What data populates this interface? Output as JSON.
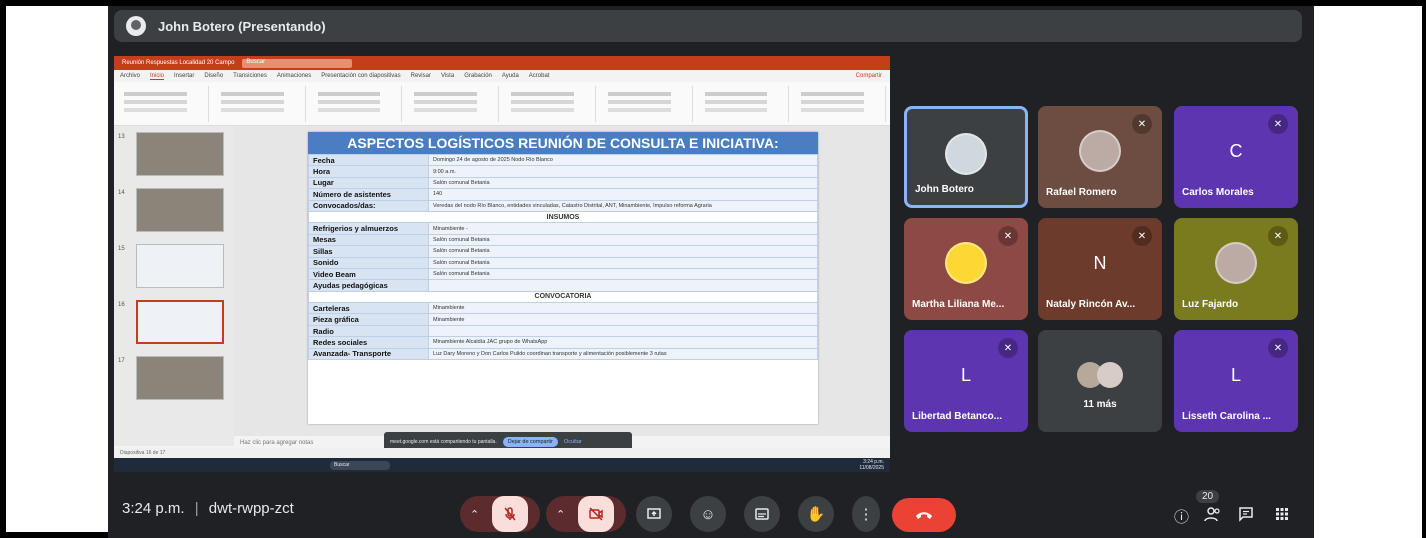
{
  "meet": {
    "presenter_label": "John Botero (Presentando)",
    "clock": "3:24 p.m.",
    "separator": "|",
    "meeting_code": "dwt-rwpp-zct",
    "participants_count": "20"
  },
  "powerpoint": {
    "title_bar": "Reunión Respuestas Localidad 20 Campo",
    "search_placeholder": "Buscar",
    "menu": [
      "Archivo",
      "Inicio",
      "Insertar",
      "Diseño",
      "Transiciones",
      "Animaciones",
      "Presentación con diapositivas",
      "Revisar",
      "Vista",
      "Grabación",
      "Ayuda",
      "Acrobat"
    ],
    "share_label": "Compartir",
    "notes_placeholder": "Haz clic para agregar notas",
    "slide_numbers": [
      "13",
      "14",
      "15",
      "16",
      "17"
    ],
    "status_left": "Diapositiva 16 de 17",
    "share_bar_text": "meet.google.com está compartiendo tu pantalla.",
    "share_stop": "Dejar de compartir",
    "share_hide": "Ocultar",
    "taskbar_search": "Buscar",
    "taskbar_time": "3:24 p.m.",
    "taskbar_date": "11/08/2025"
  },
  "slide": {
    "title": "ASPECTOS LOGÍSTICOS REUNIÓN DE CONSULTA E INICIATIVA:",
    "rows1": [
      {
        "k": "Fecha",
        "v": "Domingo 24 de agosto de 2025 Nodo Río Blanco"
      },
      {
        "k": "Hora",
        "v": "9:00 a.m."
      },
      {
        "k": "Lugar",
        "v": "Salón comunal Betania"
      },
      {
        "k": "Número de asistentes",
        "v": "140"
      },
      {
        "k": "Convocados/das:",
        "v": "Veredas del nodo Río Blanco, entidades vinculadas, Catastro Distrital, ANT, Minambiente, Impulso reforma Agraria"
      }
    ],
    "section_insumos": "INSUMOS",
    "rows2": [
      {
        "k": "Refrigerios y almuerzos",
        "v": "Minambiente -"
      },
      {
        "k": "Mesas",
        "v": "Salón comunal Betania"
      },
      {
        "k": "Sillas",
        "v": "Salón comunal Betania"
      },
      {
        "k": "Sonido",
        "v": "Salón comunal Betania"
      },
      {
        "k": "Video Beam",
        "v": "Salón comunal Betania"
      },
      {
        "k": "Ayudas pedagógicas",
        "v": ""
      }
    ],
    "section_convocatoria": "CONVOCATORIA",
    "rows3": [
      {
        "k": "Carteleras",
        "v": "Minambiente"
      },
      {
        "k": "Pieza gráfica",
        "v": "Minambiente"
      },
      {
        "k": "Radio",
        "v": ""
      },
      {
        "k": "Redes sociales",
        "v": "Minambiente Alcaldía JAC grupo de WhatsApp"
      },
      {
        "k": "Avanzada- Transporte",
        "v": "Luz Dary Moreno y Don Carlos Pulido coordinan transporte y alimentación posiblemente 3 rutas"
      }
    ]
  },
  "tiles": [
    {
      "name": "John Botero",
      "initial": "",
      "bg": "#3c4043",
      "muted": false,
      "active": true
    },
    {
      "name": "Rafael Romero",
      "initial": "",
      "bg": "#6d4c41",
      "muted": true
    },
    {
      "name": "Carlos Morales",
      "initial": "C",
      "bg": "#5e35b1",
      "muted": true
    },
    {
      "name": "Martha Liliana Me...",
      "initial": "",
      "bg": "#8d4a44",
      "muted": true
    },
    {
      "name": "Nataly Rincón Av...",
      "initial": "N",
      "bg": "#6d3b2b",
      "muted": true
    },
    {
      "name": "Luz Fajardo",
      "initial": "",
      "bg": "#7a7a1e",
      "muted": true
    },
    {
      "name": "Libertad Betanco...",
      "initial": "L",
      "bg": "#5e35b1",
      "muted": true
    },
    {
      "name": "11 más",
      "initial": "",
      "bg": "#3c4043",
      "muted": false
    },
    {
      "name": "Lisseth Carolina ...",
      "initial": "L",
      "bg": "#5e35b1",
      "muted": true
    }
  ],
  "colors": {
    "meet_bg": "#202124",
    "hangup": "#ea4335",
    "slide_title_bg": "#4a7ec2",
    "ppt_accent": "#c43e1c"
  },
  "icons": [
    "mic-off-icon",
    "camera-off-icon",
    "present-icon",
    "emoji-icon",
    "captions-icon",
    "raise-hand-icon",
    "more-icon",
    "hangup-icon",
    "info-icon",
    "people-icon",
    "chat-icon",
    "activities-icon"
  ]
}
